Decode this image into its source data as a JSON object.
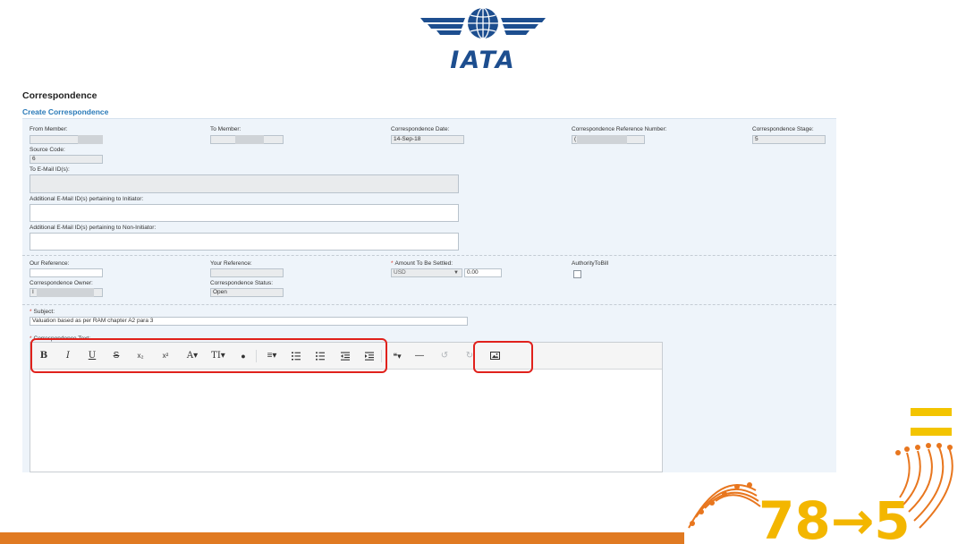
{
  "logo": {
    "text": "IATA"
  },
  "page": {
    "title": "Correspondence",
    "section": "Create Correspondence"
  },
  "form": {
    "from_member": {
      "label": "From Member:"
    },
    "to_member": {
      "label": "To Member:"
    },
    "correspondence_date": {
      "label": "Correspondence Date:",
      "value": "14-Sep-18"
    },
    "reference_number": {
      "label": "Correspondence Reference Number:",
      "value": "("
    },
    "stage": {
      "label": "Correspondence Stage:",
      "value": "5"
    },
    "source_code": {
      "label": "Source Code:",
      "value": "6"
    },
    "to_email": {
      "label": "To E-Mail ID(s):"
    },
    "additional_initiator": {
      "label": "Additional E-Mail ID(s) pertaining to Initiator:"
    },
    "additional_non_initiator": {
      "label": "Additional E-Mail ID(s) pertaining to Non-Initiator:"
    },
    "our_reference": {
      "label": "Our Reference:"
    },
    "your_reference": {
      "label": "Your Reference:"
    },
    "amount": {
      "label": "Amount To Be Settled:",
      "currency": "USD",
      "value": "0.00"
    },
    "authority_to_bill": {
      "label": "AuthorityToBill"
    },
    "owner": {
      "label": "Correspondence Owner:",
      "value": "I"
    },
    "status": {
      "label": "Correspondence Status:",
      "value": "Open"
    },
    "subject": {
      "label": "Subject:",
      "value": "Valuation based as per RAM chapter A2 para 3"
    },
    "text": {
      "label": "Correspondence Text:"
    }
  },
  "toolbar": {
    "bold": "B",
    "italic": "I",
    "underline": "U",
    "strike": "S",
    "subscript": "x₂",
    "superscript": "x²",
    "font_color": "A▾",
    "font_size": "TI▾",
    "color_fill": "●",
    "align": "≡▾",
    "quote": "❝▾",
    "hr": "—",
    "undo": "↺",
    "redo": "↻"
  },
  "colors": {
    "accent": "#2a7ab8",
    "highlight": "#e0211c",
    "orange": "#e07a22",
    "logo": "#1d4e8f"
  },
  "decoration": {
    "text": "78→5"
  }
}
